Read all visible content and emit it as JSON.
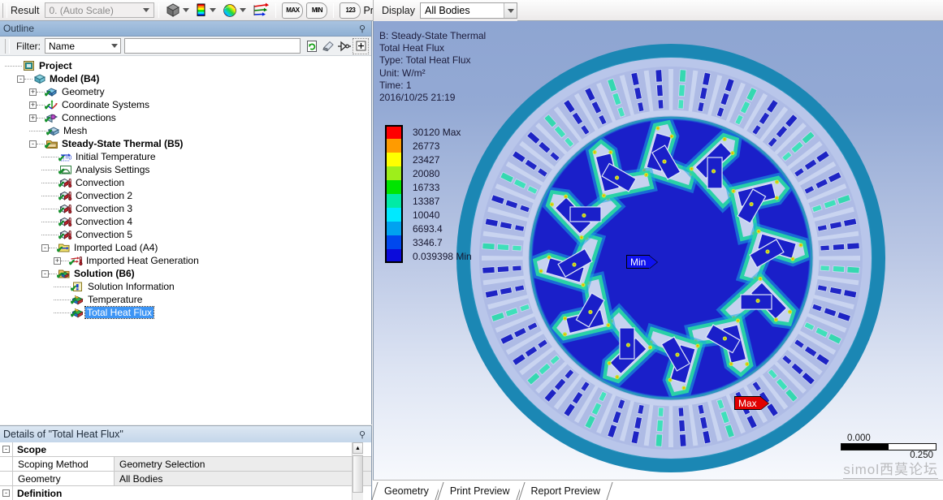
{
  "toolbar": {
    "result_label": "Result",
    "scale_value": "0. (Auto Scale)",
    "icons": [
      {
        "name": "geometry-cube-icon"
      },
      {
        "name": "contour-bands-icon"
      },
      {
        "name": "color-sphere-icon"
      },
      {
        "name": "vector-arrows-icon"
      },
      {
        "name": "max-probe-icon",
        "text": "MAX"
      },
      {
        "name": "min-probe-icon",
        "text": "MIN"
      },
      {
        "name": "probe-123-icon",
        "text": "123"
      }
    ],
    "probe_label": "Probe",
    "display_label": "Display",
    "display_value": "All Bodies"
  },
  "outline": {
    "title": "Outline",
    "filter_label": "Filter:",
    "filter_value": "Name",
    "filter_text": "",
    "buttons": [
      {
        "name": "refresh-icon"
      },
      {
        "name": "clear-eraser-icon"
      },
      {
        "name": "probe-pin-icon"
      },
      {
        "name": "expand-all-icon"
      }
    ],
    "tree": [
      {
        "label": "Project",
        "indent": 0,
        "expander": "",
        "icon": "project-icon",
        "bold": true,
        "check": false,
        "selected": false
      },
      {
        "label": "Model (B4)",
        "indent": 1,
        "expander": "-",
        "icon": "model-icon",
        "bold": true,
        "check": false,
        "selected": false
      },
      {
        "label": "Geometry",
        "indent": 2,
        "expander": "+",
        "icon": "geometry-icon",
        "bold": false,
        "check": true,
        "selected": false
      },
      {
        "label": "Coordinate Systems",
        "indent": 2,
        "expander": "+",
        "icon": "coord-sys-icon",
        "bold": false,
        "check": true,
        "selected": false
      },
      {
        "label": "Connections",
        "indent": 2,
        "expander": "+",
        "icon": "connections-icon",
        "bold": false,
        "check": true,
        "selected": false
      },
      {
        "label": "Mesh",
        "indent": 2,
        "expander": "",
        "icon": "mesh-icon",
        "bold": false,
        "check": true,
        "selected": false
      },
      {
        "label": "Steady-State Thermal (B5)",
        "indent": 2,
        "expander": "-",
        "icon": "folder-env-icon",
        "bold": true,
        "check": true,
        "selected": false
      },
      {
        "label": "Initial Temperature",
        "indent": 3,
        "expander": "",
        "icon": "initial-temp-icon",
        "bold": false,
        "check": true,
        "selected": false
      },
      {
        "label": "Analysis Settings",
        "indent": 3,
        "expander": "",
        "icon": "analysis-settings-icon",
        "bold": false,
        "check": true,
        "selected": false
      },
      {
        "label": "Convection",
        "indent": 3,
        "expander": "",
        "icon": "convection-icon",
        "bold": false,
        "check": true,
        "selected": false
      },
      {
        "label": "Convection 2",
        "indent": 3,
        "expander": "",
        "icon": "convection-icon",
        "bold": false,
        "check": true,
        "selected": false
      },
      {
        "label": "Convection 3",
        "indent": 3,
        "expander": "",
        "icon": "convection-icon",
        "bold": false,
        "check": true,
        "selected": false
      },
      {
        "label": "Convection 4",
        "indent": 3,
        "expander": "",
        "icon": "convection-icon",
        "bold": false,
        "check": true,
        "selected": false
      },
      {
        "label": "Convection 5",
        "indent": 3,
        "expander": "",
        "icon": "convection-icon",
        "bold": false,
        "check": true,
        "selected": false
      },
      {
        "label": "Imported Load (A4)",
        "indent": 3,
        "expander": "-",
        "icon": "imported-load-icon",
        "bold": false,
        "check": true,
        "selected": false
      },
      {
        "label": "Imported Heat Generation",
        "indent": 4,
        "expander": "+",
        "icon": "heat-gen-icon",
        "bold": false,
        "check": true,
        "selected": false
      },
      {
        "label": "Solution (B6)",
        "indent": 3,
        "expander": "-",
        "icon": "solution-icon",
        "bold": true,
        "check": true,
        "selected": false
      },
      {
        "label": "Solution Information",
        "indent": 4,
        "expander": "",
        "icon": "solution-info-icon",
        "bold": false,
        "check": true,
        "selected": false
      },
      {
        "label": "Temperature",
        "indent": 4,
        "expander": "",
        "icon": "result-icon",
        "bold": false,
        "check": true,
        "selected": false
      },
      {
        "label": "Total Heat Flux",
        "indent": 4,
        "expander": "",
        "icon": "result-icon",
        "bold": false,
        "check": true,
        "selected": true
      }
    ]
  },
  "details": {
    "title": "Details of \"Total Heat Flux\"",
    "rows": [
      {
        "type": "header",
        "label": "Scope"
      },
      {
        "type": "pair",
        "key": "Scoping Method",
        "value": "Geometry Selection"
      },
      {
        "type": "pair",
        "key": "Geometry",
        "value": "All Bodies"
      },
      {
        "type": "header",
        "label": "Definition"
      }
    ]
  },
  "viewport": {
    "result_info": [
      "B: Steady-State Thermal",
      "Total Heat Flux",
      "Type: Total Heat Flux",
      "Unit: W/m²",
      "Time: 1",
      "2016/10/25 21:19"
    ],
    "legend": [
      {
        "value": "30120 Max",
        "color": "#ff0000"
      },
      {
        "value": "26773",
        "color": "#ff9b00"
      },
      {
        "value": "23427",
        "color": "#ffff00"
      },
      {
        "value": "20080",
        "color": "#9eee1b"
      },
      {
        "value": "16733",
        "color": "#00e500"
      },
      {
        "value": "13387",
        "color": "#00eba6"
      },
      {
        "value": "10040",
        "color": "#00e9ff"
      },
      {
        "value": "6693.4",
        "color": "#00a2f0"
      },
      {
        "value": "3346.7",
        "color": "#0048ee"
      },
      {
        "value": "0.039398 Min",
        "color": "#0b0bdb"
      }
    ],
    "min_tag": "Min",
    "max_tag": "Max",
    "scale_min": "0.000",
    "scale_max": "0.250",
    "watermark": "simol西莫论坛"
  },
  "tabs": [
    {
      "label": "Geometry",
      "active": true
    },
    {
      "label": "Print Preview",
      "active": false
    },
    {
      "label": "Report Preview",
      "active": false
    }
  ]
}
